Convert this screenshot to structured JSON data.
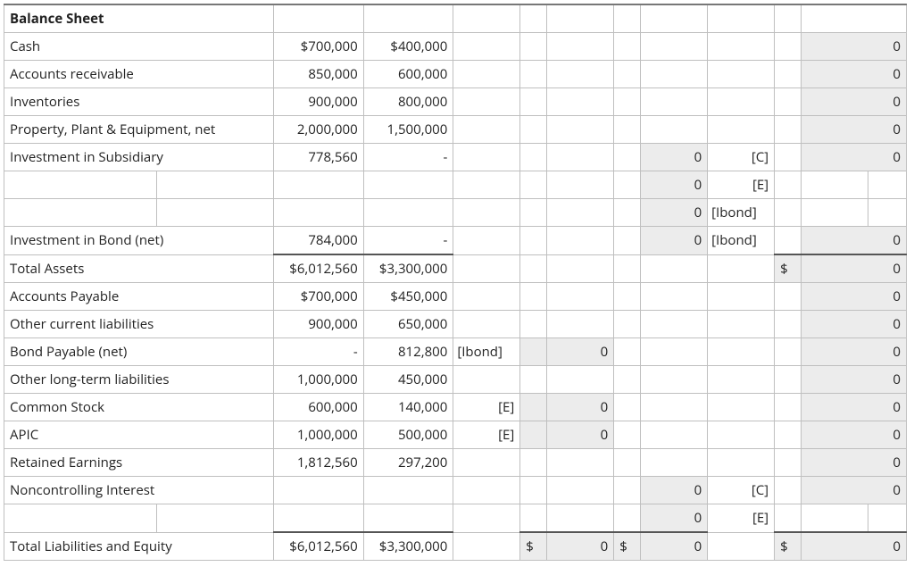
{
  "title": "Balance Sheet",
  "rows": {
    "cash": {
      "label": "Cash",
      "v1": "$700,000",
      "v2": "$400,000",
      "r": "0"
    },
    "ar": {
      "label": "Accounts receivable",
      "v1": "850,000",
      "v2": "600,000",
      "r": "0"
    },
    "inv": {
      "label": "Inventories",
      "v1": "900,000",
      "v2": "800,000",
      "r": "0"
    },
    "ppe": {
      "label": "Property, Plant & Equipment, net",
      "v1": "2,000,000",
      "v2": "1,500,000",
      "r": "0"
    },
    "isub": {
      "label": "Investment in Subsidiary",
      "v1": "778,560",
      "v2": "-",
      "c5": "0",
      "ref5": "[C]",
      "r": "0"
    },
    "blank1": {
      "c5": "0",
      "ref5": "[E]"
    },
    "blank2": {
      "c5": "0",
      "ref5": "[Ibond]"
    },
    "ibond": {
      "label": "Investment in Bond (net)",
      "v1": "784,000",
      "v2": "-",
      "c5": "0",
      "ref5": "[Ibond]",
      "r": "0"
    },
    "tassets": {
      "label": "Total Assets",
      "v1": "$6,012,560",
      "v2": "$3,300,000",
      "rsym": "$",
      "r": "0"
    },
    "ap": {
      "label": "Accounts Payable",
      "v1": "$700,000",
      "v2": "$450,000",
      "r": "0"
    },
    "ocl": {
      "label": "Other current liabilities",
      "v1": "900,000",
      "v2": "650,000",
      "r": "0"
    },
    "bp": {
      "label": "Bond Payable (net)",
      "v1": "-",
      "v2": "812,800",
      "ref3": "[Ibond]",
      "c3": "0",
      "r": "0"
    },
    "oll": {
      "label": "Other long-term liabilities",
      "v1": "1,000,000",
      "v2": "450,000",
      "r": "0"
    },
    "cs": {
      "label": "Common Stock",
      "v1": "600,000",
      "v2": "140,000",
      "ref3": "[E]",
      "c3": "0",
      "r": "0"
    },
    "apic": {
      "label": "APIC",
      "v1": "1,000,000",
      "v2": "500,000",
      "ref3": "[E]",
      "c3": "0",
      "r": "0"
    },
    "re": {
      "label": "Retained Earnings",
      "v1": "1,812,560",
      "v2": "297,200",
      "r": "0"
    },
    "nci": {
      "label": "Noncontrolling Interest",
      "c5": "0",
      "ref5": "[C]",
      "r": "0"
    },
    "blank3": {
      "c5": "0",
      "ref5": "[E]"
    },
    "tle": {
      "label": "Total Liabilities and Equity",
      "v1": "$6,012,560",
      "v2": "$3,300,000",
      "c3sym": "$",
      "c3": "0",
      "c4sym": "$",
      "c4": "0",
      "rsym": "$",
      "r": "0"
    }
  }
}
